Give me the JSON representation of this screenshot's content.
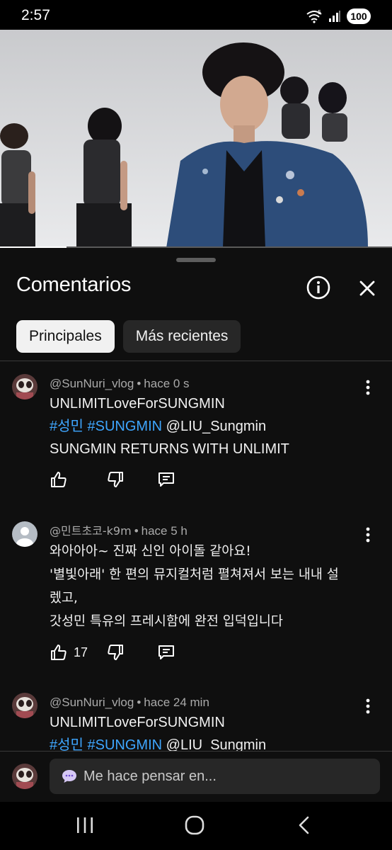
{
  "status_bar": {
    "time": "2:57",
    "battery": "100",
    "network": "5"
  },
  "video": {
    "progress_fraction": 0.17
  },
  "sheet": {
    "title": "Comentarios",
    "chips": [
      {
        "label": "Principales",
        "active": true
      },
      {
        "label": "Más recientes",
        "active": false
      }
    ]
  },
  "comments": [
    {
      "author": "@SunNuri_vlog",
      "time": "hace 0 s",
      "line1": "UNLIMITLoveForSUNGMIN",
      "hashtag1": "#성민",
      "hashtag2": "#SUNGMIN",
      "mention": "@LIU_Sungmin",
      "line3": "SUNGMIN RETURNS WITH UNLIMIT",
      "likes": ""
    },
    {
      "author": "@민트초코-k9m",
      "time": "hace 5 h",
      "line1": "와아아아~ 진짜 신인 아이돌 같아요!",
      "line2": "'별빛아래' 한 편의 뮤지컬처럼 펼쳐져서 보는 내내 설",
      "line3": "렜고,",
      "line4": "갓성민 특유의 프레시함에 완전 입덕입니다",
      "likes": "17"
    },
    {
      "author": "@SunNuri_vlog",
      "time": "hace 24 min",
      "line1": "UNLIMITLoveForSUNGMIN",
      "hashtag1": "#성민",
      "hashtag2": "#SUNGMIN",
      "mention": "@LIU_Sungmin"
    }
  ],
  "input": {
    "placeholder": "Me hace pensar en..."
  },
  "colors": {
    "background": "#0f0f0f",
    "hashtag": "#3ea6ff",
    "chip_active": "#f1f1f1",
    "chip_inactive": "#272727",
    "meta_text": "#aaaaaa"
  }
}
